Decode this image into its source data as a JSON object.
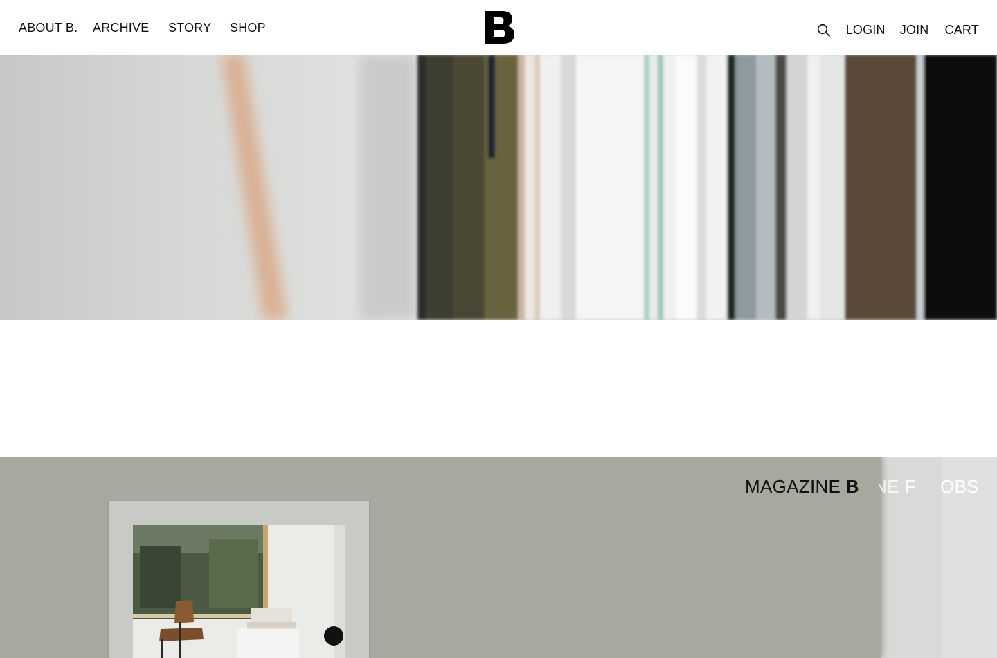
{
  "header": {
    "nav_left": [
      "ABOUT B.",
      "ARCHIVE",
      "STORY",
      "SHOP"
    ],
    "logo_text": "B",
    "nav_right": {
      "login": "LOGIN",
      "join": "JOIN",
      "cart": "CART"
    },
    "search_icon": "search-icon"
  },
  "section_tabs": {
    "magazine": {
      "prefix": "MAGAZINE",
      "letter": "B"
    },
    "f_tab": "NE F",
    "jobs_tab": "OBS"
  },
  "colors": {
    "text": "#111111",
    "panel_main": "#a8a89e",
    "panel_secondary": "#d9d9d7",
    "background": "#ffffff"
  }
}
